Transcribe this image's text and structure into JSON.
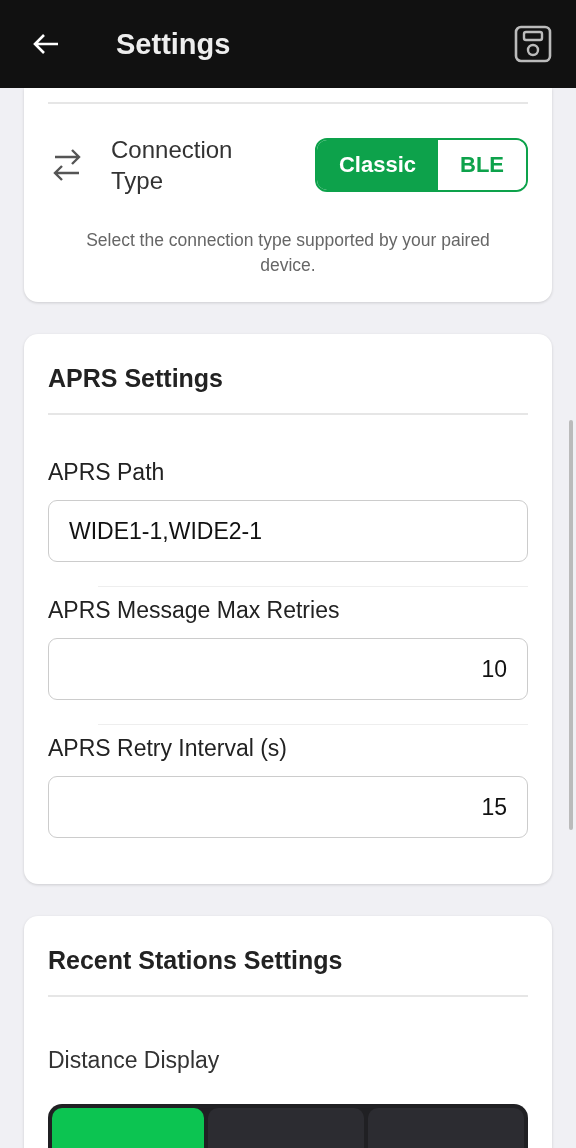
{
  "header": {
    "title": "Settings"
  },
  "connection": {
    "label": "Connection Type",
    "options": [
      {
        "label": "Classic",
        "selected": true
      },
      {
        "label": "BLE",
        "selected": false
      }
    ],
    "hint": "Select the connection type supported by your paired device."
  },
  "aprs": {
    "title": "APRS Settings",
    "fields": [
      {
        "label": "APRS Path",
        "value": "WIDE1-1,WIDE2-1",
        "kind": "text"
      },
      {
        "label": "APRS Message Max Retries",
        "value": "10",
        "kind": "number"
      },
      {
        "label": "APRS Retry Interval (s)",
        "value": "15",
        "kind": "number"
      }
    ]
  },
  "recent": {
    "title": "Recent Stations Settings",
    "distance_label": "Distance Display",
    "options": [
      {
        "selected": true
      },
      {
        "selected": false
      },
      {
        "selected": false
      }
    ]
  }
}
